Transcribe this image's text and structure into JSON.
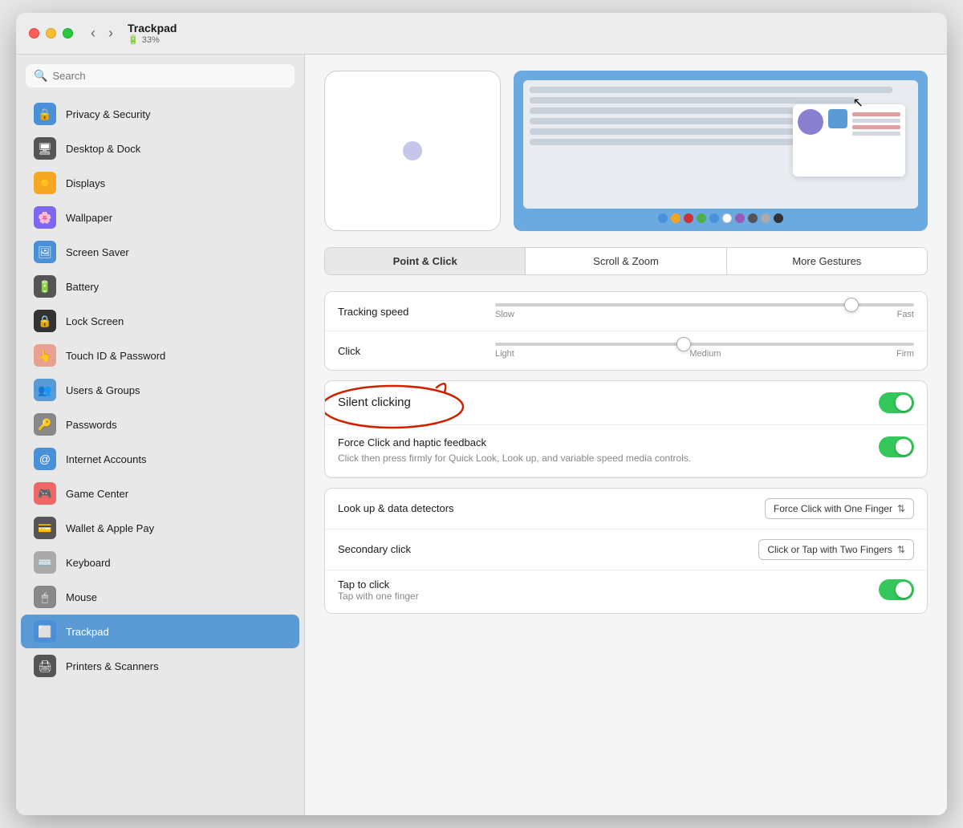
{
  "window": {
    "title": "Trackpad",
    "battery": "33%",
    "battery_icon": "🔋"
  },
  "titlebar": {
    "back_label": "‹",
    "forward_label": "›"
  },
  "sidebar": {
    "search_placeholder": "Search",
    "items": [
      {
        "id": "privacy",
        "label": "Privacy & Security",
        "icon": "🔒",
        "icon_class": "icon-privacy",
        "active": false
      },
      {
        "id": "desktop",
        "label": "Desktop & Dock",
        "icon": "🖥",
        "icon_class": "icon-desktop",
        "active": false
      },
      {
        "id": "displays",
        "label": "Displays",
        "icon": "☀️",
        "icon_class": "icon-displays",
        "active": false
      },
      {
        "id": "wallpaper",
        "label": "Wallpaper",
        "icon": "🌸",
        "icon_class": "icon-wallpaper",
        "active": false
      },
      {
        "id": "screensaver",
        "label": "Screen Saver",
        "icon": "🖼",
        "icon_class": "icon-screensaver",
        "active": false
      },
      {
        "id": "battery",
        "label": "Battery",
        "icon": "🔋",
        "icon_class": "icon-battery",
        "active": false
      },
      {
        "id": "lockscreen",
        "label": "Lock Screen",
        "icon": "🔒",
        "icon_class": "icon-lockscreen",
        "active": false
      },
      {
        "id": "touchid",
        "label": "Touch ID & Password",
        "icon": "👆",
        "icon_class": "icon-touchid",
        "active": false
      },
      {
        "id": "users",
        "label": "Users & Groups",
        "icon": "👥",
        "icon_class": "icon-users",
        "active": false
      },
      {
        "id": "passwords",
        "label": "Passwords",
        "icon": "🔑",
        "icon_class": "icon-passwords",
        "active": false
      },
      {
        "id": "internet",
        "label": "Internet Accounts",
        "icon": "@",
        "icon_class": "icon-internet",
        "active": false
      },
      {
        "id": "gamecenter",
        "label": "Game Center",
        "icon": "🎮",
        "icon_class": "icon-gamecenter",
        "active": false
      },
      {
        "id": "wallet",
        "label": "Wallet & Apple Pay",
        "icon": "💳",
        "icon_class": "icon-wallet",
        "active": false
      },
      {
        "id": "keyboard",
        "label": "Keyboard",
        "icon": "⌨️",
        "icon_class": "icon-keyboard",
        "active": false
      },
      {
        "id": "mouse",
        "label": "Mouse",
        "icon": "🖱",
        "icon_class": "icon-mouse",
        "active": false
      },
      {
        "id": "trackpad",
        "label": "Trackpad",
        "icon": "⬜",
        "icon_class": "icon-trackpad",
        "active": true
      },
      {
        "id": "printers",
        "label": "Printers & Scanners",
        "icon": "🖨",
        "icon_class": "icon-printers",
        "active": false
      }
    ]
  },
  "tabs": [
    {
      "id": "point-click",
      "label": "Point & Click",
      "active": true
    },
    {
      "id": "scroll-zoom",
      "label": "Scroll & Zoom",
      "active": false
    },
    {
      "id": "more-gestures",
      "label": "More Gestures",
      "active": false
    }
  ],
  "settings": {
    "tracking_speed": {
      "label": "Tracking speed",
      "value": 85,
      "min_label": "Slow",
      "max_label": "Fast"
    },
    "click": {
      "label": "Click",
      "value": 45,
      "labels": [
        "Light",
        "Medium",
        "Firm"
      ]
    },
    "silent_clicking": {
      "label": "Silent clicking",
      "enabled": true
    },
    "force_click": {
      "label": "Force Click and haptic feedback",
      "description": "Click then press firmly for Quick Look, Look up, and variable speed media controls.",
      "enabled": true
    },
    "lookup_data": {
      "label": "Look up & data detectors",
      "value": "Force Click with One Finger"
    },
    "secondary_click": {
      "label": "Secondary click",
      "value": "Click or Tap with Two Fingers"
    },
    "tap_to_click": {
      "label": "Tap to click",
      "description": "Tap with one finger",
      "enabled": true
    }
  },
  "color_dots": [
    "#4a90d9",
    "#f5a623",
    "#cc3333",
    "#4caf50",
    "#4a90d9",
    "#e8e8e8",
    "#9b59b6",
    "#666",
    "#aaa",
    "#555"
  ]
}
